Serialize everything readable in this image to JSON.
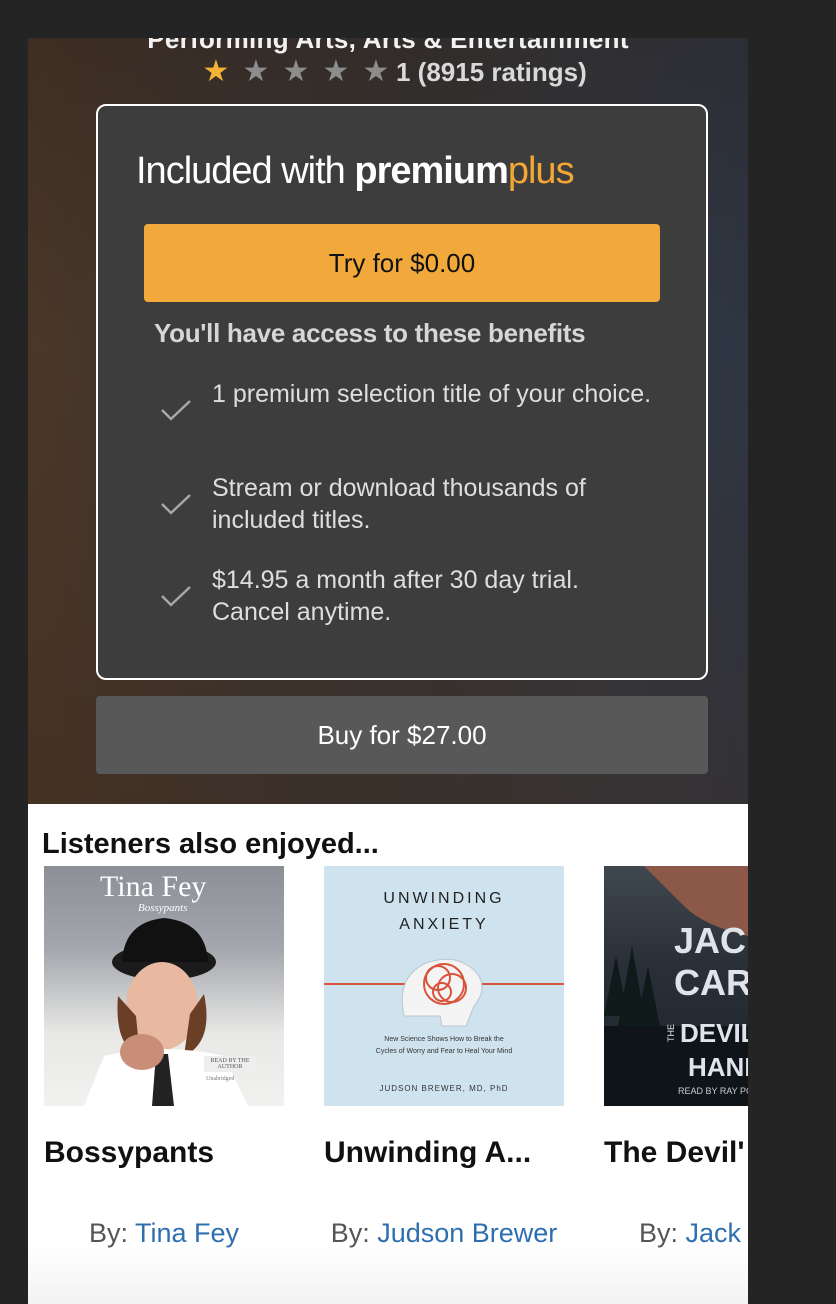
{
  "hero": {
    "category": "Performing Arts, Arts & Entertainment",
    "rating": {
      "stars_filled": 1,
      "stars_total": 5,
      "text": "1 (8915 ratings)"
    }
  },
  "plan": {
    "title_prefix": "Included with ",
    "brand_primary": "premium",
    "brand_secondary": "plus",
    "try_label": "Try for $0.00",
    "benefits_title": "You'll have access to these benefits",
    "benefits": [
      "1 premium selection title of your choice.",
      "Stream or download thousands of included titles.",
      "$14.95 a month after 30 day trial. Cancel anytime."
    ],
    "buy_label": "Buy for $27.00"
  },
  "also_enjoyed": {
    "heading": "Listeners also enjoyed...",
    "by_label": "By: ",
    "books": [
      {
        "title": "Bossypants",
        "author": "Tina Fey",
        "cover_text": [
          "Tina Fey",
          "Bossypants",
          "READ BY THE AUTHOR",
          "Unabridged"
        ]
      },
      {
        "title": "Unwinding A...",
        "author": "Judson Brewer",
        "cover_text": [
          "UNWINDING",
          "ANXIETY",
          "New Science Shows How to Break the Cycles of Worry and Fear to Heal Your Mind",
          "JUDSON BREWER, MD, PhD"
        ]
      },
      {
        "title": "The Devil'",
        "author": "Jack",
        "cover_text": [
          "JAC",
          "CAR",
          "DEVIL",
          "HANI",
          "THE",
          "READ BY RAY PO"
        ]
      }
    ]
  },
  "colors": {
    "accent": "#f2a93b",
    "brand_plus": "#f3a736",
    "link": "#2e6fb0",
    "star_on": "#f5b335"
  }
}
